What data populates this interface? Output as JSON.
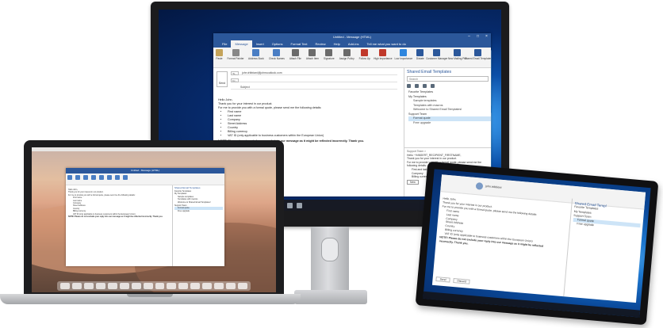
{
  "monitor": {
    "window_title": "Untitled - Message (HTML)",
    "tell_me": "Tell me what you want to do",
    "tabs": [
      "File",
      "Message",
      "Insert",
      "Options",
      "Format Text",
      "Review",
      "Help",
      "Add-ins"
    ],
    "ribbon": [
      {
        "label": "Paste",
        "color": "#c4a35a"
      },
      {
        "label": "Format Painter",
        "color": "#888888"
      },
      {
        "label": "Address Book",
        "color": "#4a7ec4"
      },
      {
        "label": "Check Names",
        "color": "#4a7ec4"
      },
      {
        "label": "Attach File",
        "color": "#6b6b6b"
      },
      {
        "label": "Attach Item",
        "color": "#6b6b6b"
      },
      {
        "label": "Signature",
        "color": "#6b6b6b"
      },
      {
        "label": "Assign Policy",
        "color": "#6b6b6b"
      },
      {
        "label": "Follow Up",
        "color": "#c0392b"
      },
      {
        "label": "High Importance",
        "color": "#c0392b"
      },
      {
        "label": "Low Importance",
        "color": "#2e86de"
      },
      {
        "label": "Dictate",
        "color": "#2b579a"
      },
      {
        "label": "Customer Manager",
        "color": "#2b579a"
      },
      {
        "label": "New Mailing Poll",
        "color": "#2b579a"
      },
      {
        "label": "Shared Email Templates",
        "color": "#2b579a"
      },
      {
        "label": "Insights",
        "color": "#5b9bd5"
      },
      {
        "label": "Show templates",
        "color": "#2b579a"
      }
    ],
    "send_label": "Send",
    "to_label": "To...",
    "cc_label": "Cc...",
    "to_value": "john.tribbiani@johnsoutlook.com",
    "subject_label": "Subject",
    "message": {
      "greeting": "Hello John,",
      "line1": "Thank you for your interest in our product.",
      "line2": "For me to provide you with a formal quote, please send me the following details:",
      "items": [
        "First name",
        "Last name",
        "Company",
        "Street Address",
        "Country",
        "Billing currency",
        "VAT ID (only applicable to business customers within the European Union)"
      ],
      "note": "NOTE! Please do not exclude your reply into our message as it might be reflected incorrectly. Thank you."
    },
    "pane": {
      "title": "Shared Email Templates",
      "search_placeholder": "Search",
      "favorite": "Favorite Templates",
      "my_templates": "My Templates",
      "my_items": [
        "Sample templates",
        "Templates with macros",
        "Welcome to Shared Email Templates!"
      ],
      "support": "Support Team",
      "support_items": [
        "Formal quote",
        "Free upgrade"
      ],
      "preview_title": "Support Team >",
      "preview": [
        "Hello ~%INSERT_RECIPIENT_FIRSTNAME,",
        "Thank you for your interest in our product.",
        "For me to provide you with a formal quote, please send me the following details:",
        "First and last name",
        "Company",
        "Billing currency"
      ],
      "new_btn": "New"
    }
  },
  "laptop": {
    "window_title": "Untitled - Message (HTML)",
    "body": [
      "Hello John,",
      "Thank you for your interest in our product.",
      "For me to provide you with a formal quote, please send me the following details:",
      "First name",
      "Last name",
      "Company",
      "Street Address",
      "Country",
      "Billing currency",
      "VAT ID (only applicable to business customers within the European Union)",
      "NOTE! Please do not exclude your reply into our message as it might be reflected incorrectly. Thank you."
    ],
    "pane": [
      "Shared Email Templates",
      "Favorite Templates",
      "My Templates",
      "Sample templates",
      "Templates with macros",
      "Welcome to Shared Email Templates!",
      "Support Team",
      "Formal quote",
      "Free upgrade"
    ]
  },
  "tablet": {
    "from": "john.tribbiani",
    "body": [
      "Hello John,",
      "Thank you for your interest in our product.",
      "For me to provide you with a formal quote, please send me the following details:",
      "First name",
      "Last name",
      "Company",
      "Street Address",
      "Country",
      "Billing currency",
      "VAT ID (only applicable to business customers within the European Union)",
      "NOTE! Please do not exclude your reply into our message as it might be reflected incorrectly. Thank you."
    ],
    "pane_title": "Shared Email Templ",
    "pane_items": [
      "Favorite Templates",
      "My Templates",
      "Support Team",
      "Formal quote",
      "Free upgrade"
    ],
    "buttons": [
      "Send",
      "Discard"
    ]
  }
}
